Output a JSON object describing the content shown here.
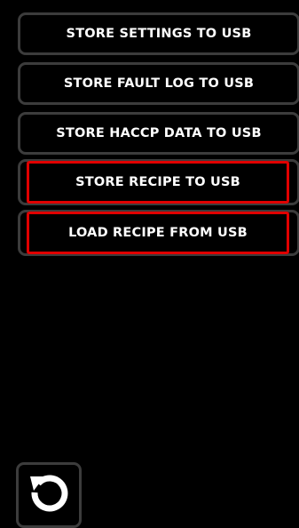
{
  "menu": {
    "items": [
      {
        "label": "STORE SETTINGS TO USB"
      },
      {
        "label": "STORE FAULT LOG TO USB"
      },
      {
        "label": "STORE HACCP DATA TO USB"
      },
      {
        "label": "STORE RECIPE TO USB",
        "selected": true
      },
      {
        "label": "LOAD RECIPE FROM USB",
        "selected": true
      }
    ]
  },
  "footer": {
    "back_icon": "refresh-icon"
  },
  "colors": {
    "background": "#000000",
    "button_border": "#3c3c3c",
    "highlight": "#e00000",
    "text": "#ffffff"
  }
}
